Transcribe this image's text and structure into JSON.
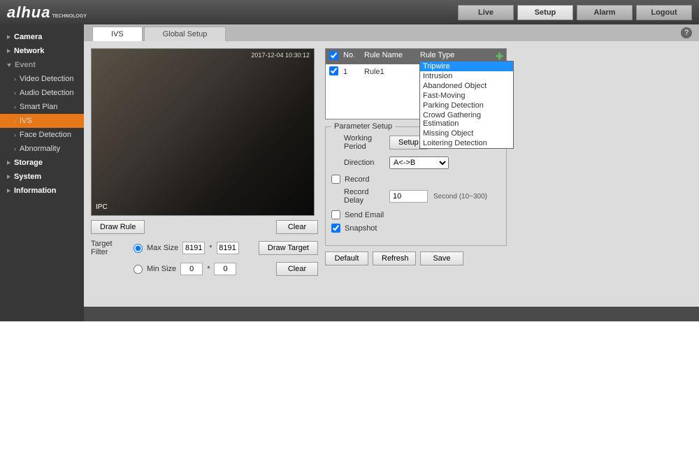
{
  "brand": {
    "name": "alhua",
    "sub": "TECHNOLOGY"
  },
  "topButtons": {
    "live": "Live",
    "setup": "Setup",
    "alarm": "Alarm",
    "logout": "Logout"
  },
  "sidebar": {
    "camera": "Camera",
    "network": "Network",
    "event": "Event",
    "video_detection": "Video Detection",
    "audio_detection": "Audio Detection",
    "smart_plan": "Smart Plan",
    "ivs": "IVS",
    "face_detection": "Face Detection",
    "abnormality": "Abnormality",
    "storage": "Storage",
    "system": "System",
    "information": "Information"
  },
  "tabs": {
    "ivs": "IVS",
    "global_setup": "Global Setup"
  },
  "preview": {
    "label": "IPC",
    "timestamp": "2017-12-04 10:30:12"
  },
  "buttons": {
    "draw_rule": "Draw Rule",
    "clear": "Clear",
    "draw_target": "Draw Target",
    "setup": "Setup",
    "default": "Default",
    "refresh": "Refresh",
    "save": "Save"
  },
  "target_filter": {
    "label": "Target Filter",
    "max_size": "Max Size",
    "min_size": "Min Size",
    "max_w": "8191",
    "max_h": "8191",
    "min_w": "0",
    "min_h": "0",
    "sep": "*"
  },
  "rule_table": {
    "hdr_no": "No.",
    "hdr_name": "Rule Name",
    "hdr_type": "Rule Type",
    "row1_no": "1",
    "row1_name": "Rule1"
  },
  "rule_types": {
    "tripwire": "Tripwire",
    "intrusion": "Intrusion",
    "abandoned": "Abandoned Object",
    "fast_moving": "Fast-Moving",
    "parking": "Parking Detection",
    "crowd": "Crowd Gathering Estimation",
    "missing": "Missing Object",
    "loitering": "Loitering Detection"
  },
  "param": {
    "legend": "Parameter Setup",
    "working_period": "Working Period",
    "direction": "Direction",
    "direction_val": "A<->B",
    "record": "Record",
    "record_delay": "Record Delay",
    "record_delay_val": "10",
    "record_delay_hint": "Second (10~300)",
    "send_email": "Send Email",
    "snapshot": "Snapshot"
  }
}
